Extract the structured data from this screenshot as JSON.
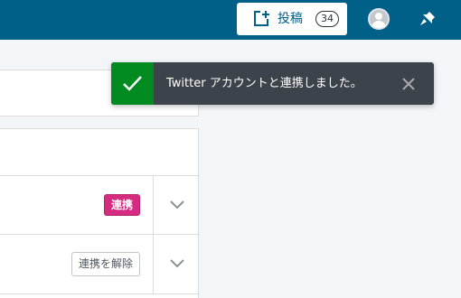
{
  "topbar": {
    "post_label": "投稿",
    "post_count": "34",
    "icons": {
      "post": "add-post-icon",
      "avatar": "user-avatar",
      "notifications": "notification-bell-icon"
    },
    "colors": {
      "bar": "#016087"
    }
  },
  "notice": {
    "message": "Twitter アカウントと連携しました。",
    "status": "success",
    "colors": {
      "success": "#008a20",
      "background": "#3c434a"
    }
  },
  "connections": {
    "rows": [
      {
        "button_label": "連携",
        "button_color": "#d52c82"
      },
      {
        "button_label": "連携を解除"
      }
    ]
  }
}
